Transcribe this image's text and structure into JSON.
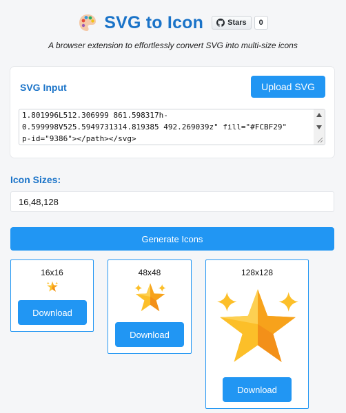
{
  "header": {
    "title": "SVG to Icon",
    "github": {
      "stars_label": "Stars",
      "count": "0"
    },
    "subtitle": "A browser extension to effortlessly convert SVG into multi-size icons"
  },
  "svg_input": {
    "label": "SVG Input",
    "upload_label": "Upload SVG",
    "content_lines": [
      "1.801996L512.306999 861.598317h-",
      "0.599998V525.5949731314.819385 492.269039z\" fill=\"#FCBF29\"",
      "p-id=\"9386\"></path></svg>"
    ]
  },
  "sizes": {
    "label": "Icon Sizes:",
    "value": "16,48,128"
  },
  "generate_label": "Generate Icons",
  "icons": [
    {
      "size_label": "16x16",
      "download_label": "Download"
    },
    {
      "size_label": "48x48",
      "download_label": "Download"
    },
    {
      "size_label": "128x128",
      "download_label": "Download"
    }
  ],
  "colors": {
    "accent": "#2196f3",
    "title": "#1a73c8",
    "star_light": "#FCBF29",
    "star_dark": "#F7A21B"
  }
}
